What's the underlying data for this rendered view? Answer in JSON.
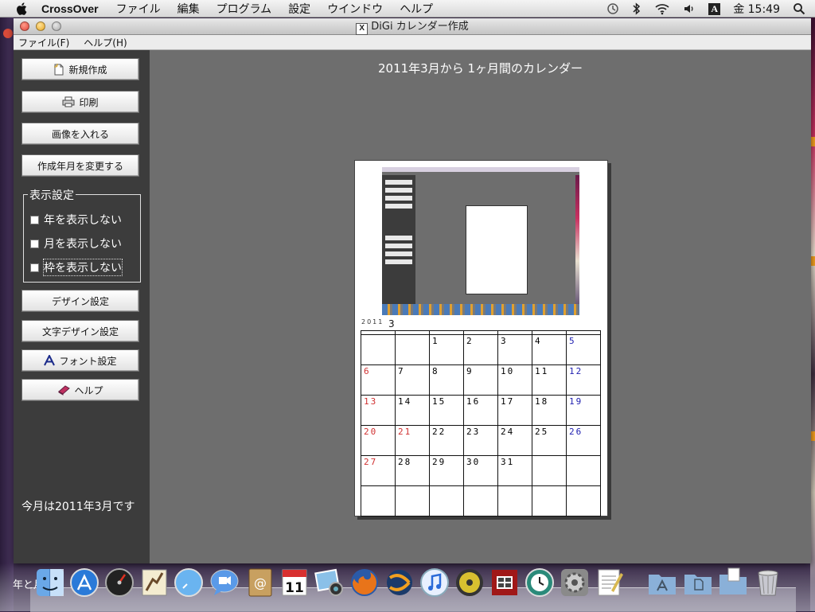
{
  "menubar": {
    "app_name": "CrossOver",
    "items": [
      "ファイル",
      "編集",
      "プログラム",
      "設定",
      "ウインドウ",
      "ヘルプ"
    ],
    "clock": "金 15:49",
    "input_indicator": "A"
  },
  "window": {
    "title": "DiGi カレンダー作成",
    "title_icon": "X",
    "menu": [
      "ファイル(F)",
      "ヘルプ(H)"
    ]
  },
  "sidebar": {
    "new_button": "新規作成",
    "print_button": "印刷",
    "image_button": "画像を入れる",
    "change_month_button": "作成年月を変更する",
    "display_group_label": "表示設定",
    "checkboxes": [
      "年を表示しない",
      "月を表示しない",
      "枠を表示しない"
    ],
    "design_button": "デザイン設定",
    "text_design_button": "文字デザイン設定",
    "font_button": "フォント設定",
    "help_button": "ヘルプ",
    "today_label": "今月は2011年3月です"
  },
  "main": {
    "heading": "2011年3月から 1ヶ月間のカレンダー",
    "calendar": {
      "year": "2011",
      "month": "3",
      "weeks": [
        [
          "",
          "",
          "1",
          "2",
          "3",
          "4",
          "5"
        ],
        [
          "6",
          "7",
          "8",
          "9",
          "10",
          "11",
          "12"
        ],
        [
          "13",
          "14",
          "15",
          "16",
          "17",
          "18",
          "19"
        ],
        [
          "20",
          "21",
          "22",
          "23",
          "24",
          "25",
          "26"
        ],
        [
          "27",
          "28",
          "29",
          "30",
          "31",
          "",
          ""
        ],
        [
          "",
          "",
          "",
          "",
          "",
          "",
          ""
        ]
      ],
      "colors": {
        "sunday": "#d03030",
        "saturday": "#2020b0",
        "holiday": "#d03030",
        "weekday": "#111111"
      }
    }
  },
  "dock": {
    "overlay_text": "年と月",
    "icons": [
      "finder-icon",
      "app-store-icon",
      "dashboard-icon",
      "mail-icon",
      "safari-icon",
      "ichat-icon",
      "address-book-icon",
      "ical-icon",
      "iphoto-icon",
      "firefox-icon",
      "crossover-icon",
      "itunes-icon",
      "dvd-player-icon",
      "photo-booth-icon",
      "time-machine-icon",
      "system-preferences-icon",
      "textedit-icon",
      "applications-folder-icon",
      "documents-folder-icon",
      "downloads-folder-icon",
      "trash-icon"
    ],
    "ical_date": "11"
  }
}
